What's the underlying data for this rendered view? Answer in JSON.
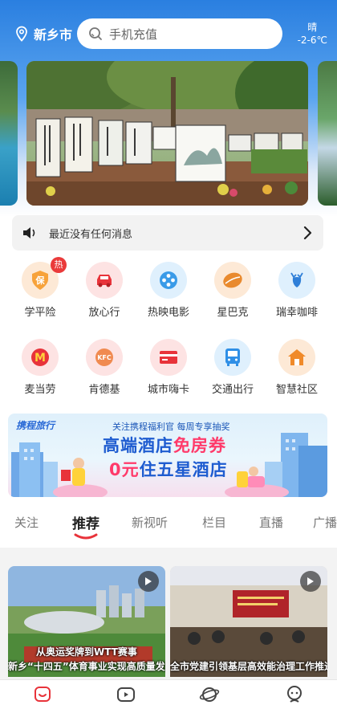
{
  "header": {
    "city": "新乡市",
    "search_placeholder": "手机充值",
    "weather_condition": "晴",
    "weather_temp": "-2-6℃"
  },
  "notice": {
    "text": "最近没有任何消息"
  },
  "services": [
    {
      "label": "学平险",
      "icon": "shield-icon",
      "badge": "热"
    },
    {
      "label": "放心行",
      "icon": "car-icon"
    },
    {
      "label": "热映电影",
      "icon": "film-reel-icon"
    },
    {
      "label": "星巴克",
      "icon": "coffee-bean-icon"
    },
    {
      "label": "瑞幸咖啡",
      "icon": "deer-icon"
    },
    {
      "label": "麦当劳",
      "icon": "mcdonalds-icon",
      "icon_text": "M"
    },
    {
      "label": "肯德基",
      "icon": "kfc-icon",
      "icon_text": "KFC"
    },
    {
      "label": "城市嗨卡",
      "icon": "card-icon"
    },
    {
      "label": "交通出行",
      "icon": "bus-icon"
    },
    {
      "label": "智慧社区",
      "icon": "home-icon"
    }
  ],
  "ad": {
    "brand": "携程旅行",
    "subtitle": "关注携程福利官 每周专享抽奖",
    "line1_a": "高端酒店",
    "line1_b": "免房券",
    "line2_a": "0元",
    "line2_b": "住五星酒店"
  },
  "tabs": [
    "关注",
    "推荐",
    "新视听",
    "栏目",
    "直播",
    "广播"
  ],
  "active_tab": "推荐",
  "feed": [
    {
      "caption_1": "从奥运奖牌到WTT赛事",
      "caption_2": "新乡“十四五”体育事业实现高质量发展"
    },
    {
      "caption_1": "",
      "caption_2": "全市党建引领基层高效能治理工作推进会召开"
    }
  ],
  "colors": {
    "accent": "#e8333a",
    "header_blue": "#2a7fe0"
  }
}
